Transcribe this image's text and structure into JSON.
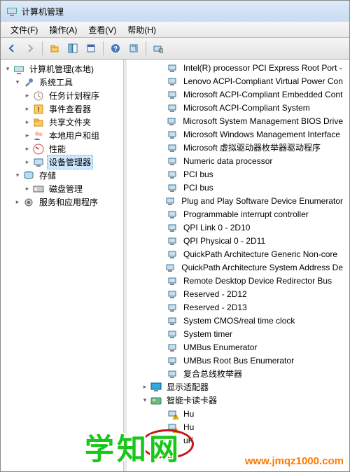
{
  "window_title": "计算机管理",
  "menu": {
    "file": "文件(F)",
    "action": "操作(A)",
    "view": "查看(V)",
    "help": "帮助(H)"
  },
  "toolbar_icons": [
    "back-icon",
    "forward-icon",
    "up-icon",
    "show-hide-icon",
    "properties-icon",
    "export-icon",
    "refresh-icon",
    "help-icon",
    "find-icon"
  ],
  "left_root": "计算机管理(本地)",
  "left_tree": [
    {
      "label": "系统工具",
      "expanded": true,
      "children": [
        {
          "label": "任务计划程序"
        },
        {
          "label": "事件查看器"
        },
        {
          "label": "共享文件夹"
        },
        {
          "label": "本地用户和组"
        },
        {
          "label": "性能"
        },
        {
          "label": "设备管理器",
          "selected": true
        }
      ]
    },
    {
      "label": "存储",
      "expanded": true,
      "children": [
        {
          "label": "磁盘管理"
        }
      ]
    },
    {
      "label": "服务和应用程序",
      "expanded": false
    }
  ],
  "devices": [
    "Intel(R) processor PCI Express Root Port -",
    "Lenovo ACPI-Compliant Virtual Power Con",
    "Microsoft ACPI-Compliant Embedded Cont",
    "Microsoft ACPI-Compliant System",
    "Microsoft System Management BIOS Drive",
    "Microsoft Windows Management Interface",
    "Microsoft 虚拟驱动器枚举器驱动程序",
    "Numeric data processor",
    "PCI bus",
    "PCI bus",
    "Plug and Play Software Device Enumerator",
    "Programmable interrupt controller",
    "QPI Link 0 - 2D10",
    "QPI Physical 0 - 2D11",
    "QuickPath Architecture Generic Non-core",
    "QuickPath Architecture System Address De",
    "Remote Desktop Device Redirector Bus",
    "Reserved - 2D12",
    "Reserved - 2D13",
    "System CMOS/real time clock",
    "System timer",
    "UMBus Enumerator",
    "UMBus Root Bus Enumerator",
    "复合总线枚举器"
  ],
  "right_categories": [
    {
      "label": "显示适配器",
      "icon": "monitor"
    },
    {
      "label": "智能卡读卡器",
      "icon": "smartcard",
      "expanded": true,
      "children": [
        {
          "label": "Hu",
          "warn": true
        },
        {
          "label": "Hu",
          "warn": true
        },
        {
          "label": "uK",
          "warn": true
        }
      ]
    }
  ],
  "watermark_text": "学知网",
  "url_text": "www.jmqz1000.com"
}
